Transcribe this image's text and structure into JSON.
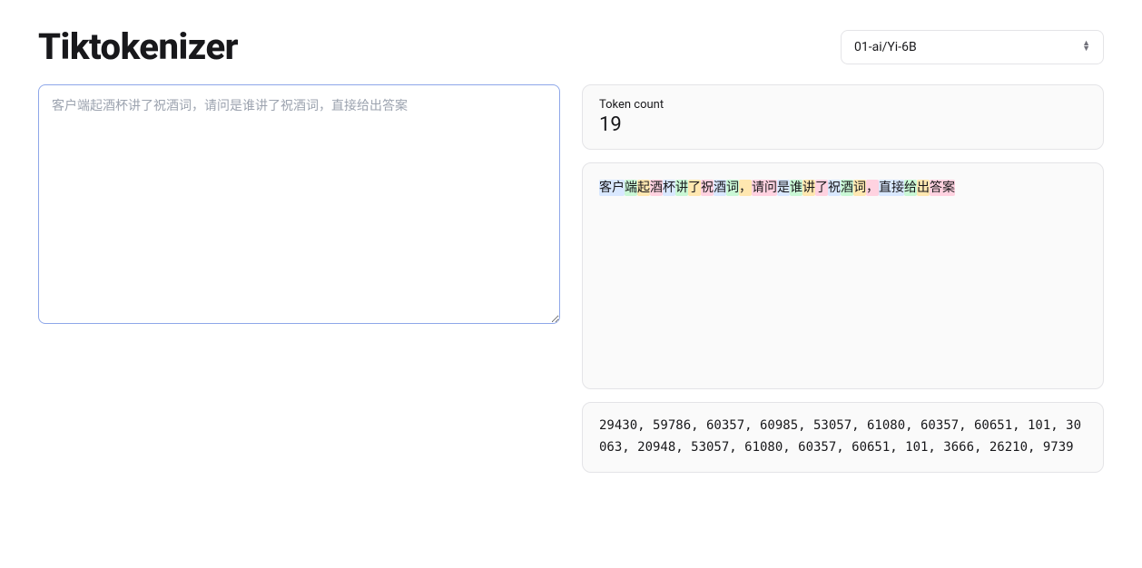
{
  "header": {
    "title": "Tiktokenizer",
    "model_selected": "01-ai/Yi-6B"
  },
  "input": {
    "text": "客户端起酒杯讲了祝酒词，请问是谁讲了祝酒词，直接给出答案"
  },
  "token_count": {
    "label": "Token count",
    "value": "19"
  },
  "tokens": [
    {
      "text": "客户",
      "color": "#d9e8ff"
    },
    {
      "text": "端",
      "color": "#c9f7d5"
    },
    {
      "text": "起",
      "color": "#ffe7b0"
    },
    {
      "text": "酒",
      "color": "#ffd2e0"
    },
    {
      "text": "杯",
      "color": "#d9e8ff"
    },
    {
      "text": "讲",
      "color": "#c9f7d5"
    },
    {
      "text": "了",
      "color": "#ffe7b0"
    },
    {
      "text": "祝",
      "color": "#ffd2e0"
    },
    {
      "text": "酒",
      "color": "#d9e8ff"
    },
    {
      "text": "词",
      "color": "#c9f7d5"
    },
    {
      "text": "，",
      "color": "#ffe7b0"
    },
    {
      "text": "请问",
      "color": "#ffd2e0"
    },
    {
      "text": "是",
      "color": "#d9e8ff"
    },
    {
      "text": "谁",
      "color": "#c9f7d5"
    },
    {
      "text": "讲",
      "color": "#ffe7b0"
    },
    {
      "text": "了",
      "color": "#ffd2e0"
    },
    {
      "text": "祝",
      "color": "#d9e8ff"
    },
    {
      "text": "酒",
      "color": "#c9f7d5"
    },
    {
      "text": "词",
      "color": "#ffe7b0"
    },
    {
      "text": "，",
      "color": "#ffd2e0"
    },
    {
      "text": "直接",
      "color": "#d9e8ff"
    },
    {
      "text": "给",
      "color": "#c9f7d5"
    },
    {
      "text": "出",
      "color": "#ffe7b0"
    },
    {
      "text": "答案",
      "color": "#ffd2e0"
    }
  ],
  "token_ids": "29430, 59786, 60357, 60985, 53057, 61080, 60357, 60651, 101, 30063, 20948, 53057, 61080, 60357, 60651, 101, 3666, 26210, 9739"
}
